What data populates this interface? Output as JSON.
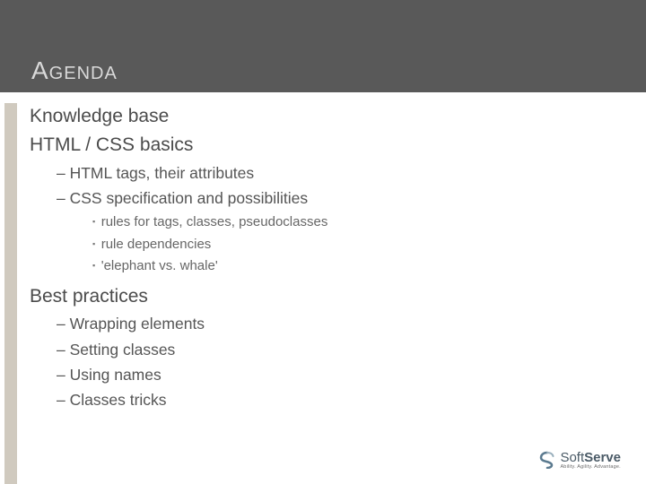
{
  "title": "Agenda",
  "items": {
    "i0": "Knowledge base",
    "i1": "HTML / CSS basics",
    "i1_0": "HTML tags, their attributes",
    "i1_1": "CSS specification and possibilities",
    "i1_1_0": "rules for tags, classes, pseudoclasses",
    "i1_1_1": "rule dependencies",
    "i1_1_2": "'elephant vs. whale'",
    "i2": "Best practices",
    "i2_0": "Wrapping elements",
    "i2_1": "Setting classes",
    "i2_2": "Using names",
    "i2_3": "Classes tricks"
  },
  "logo": {
    "name": "SoftServe",
    "tagline": "Ability. Agility. Advantage."
  }
}
